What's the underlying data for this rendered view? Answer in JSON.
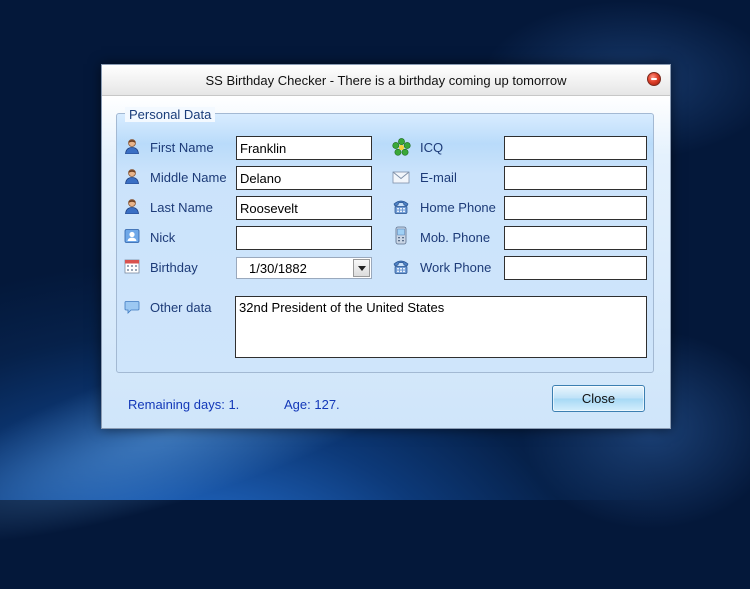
{
  "window": {
    "title": "SS Birthday Checker - There is a birthday coming up tomorrow"
  },
  "group": {
    "label": "Personal Data"
  },
  "fields": {
    "first_name": {
      "label": "First Name",
      "value": "Franklin",
      "icon": "person-icon"
    },
    "middle_name": {
      "label": "Middle Name",
      "value": "Delano",
      "icon": "person-icon"
    },
    "last_name": {
      "label": "Last Name",
      "value": "Roosevelt",
      "icon": "person-icon"
    },
    "nick": {
      "label": "Nick",
      "value": "",
      "icon": "id-card-icon"
    },
    "birthday": {
      "label": "Birthday",
      "value": "1/30/1882",
      "icon": "calendar-icon"
    },
    "icq": {
      "label": "ICQ",
      "value": "",
      "icon": "icq-flower-icon"
    },
    "email": {
      "label": "E-mail",
      "value": "",
      "icon": "envelope-icon"
    },
    "home_phone": {
      "label": "Home Phone",
      "value": "",
      "icon": "phone-icon"
    },
    "mob_phone": {
      "label": "Mob. Phone",
      "value": "",
      "icon": "mobile-phone-icon"
    },
    "work_phone": {
      "label": "Work Phone",
      "value": "",
      "icon": "phone-icon"
    },
    "other_data": {
      "label": "Other data",
      "value": "32nd President of the United States",
      "icon": "speech-bubble-icon"
    }
  },
  "status": {
    "remaining": "Remaining days: 1.",
    "age": "Age: 127."
  },
  "buttons": {
    "close": "Close"
  },
  "colors": {
    "label_text": "#1d3b78",
    "status_text": "#1338b8",
    "panel_blue": "#cfe5fa"
  }
}
